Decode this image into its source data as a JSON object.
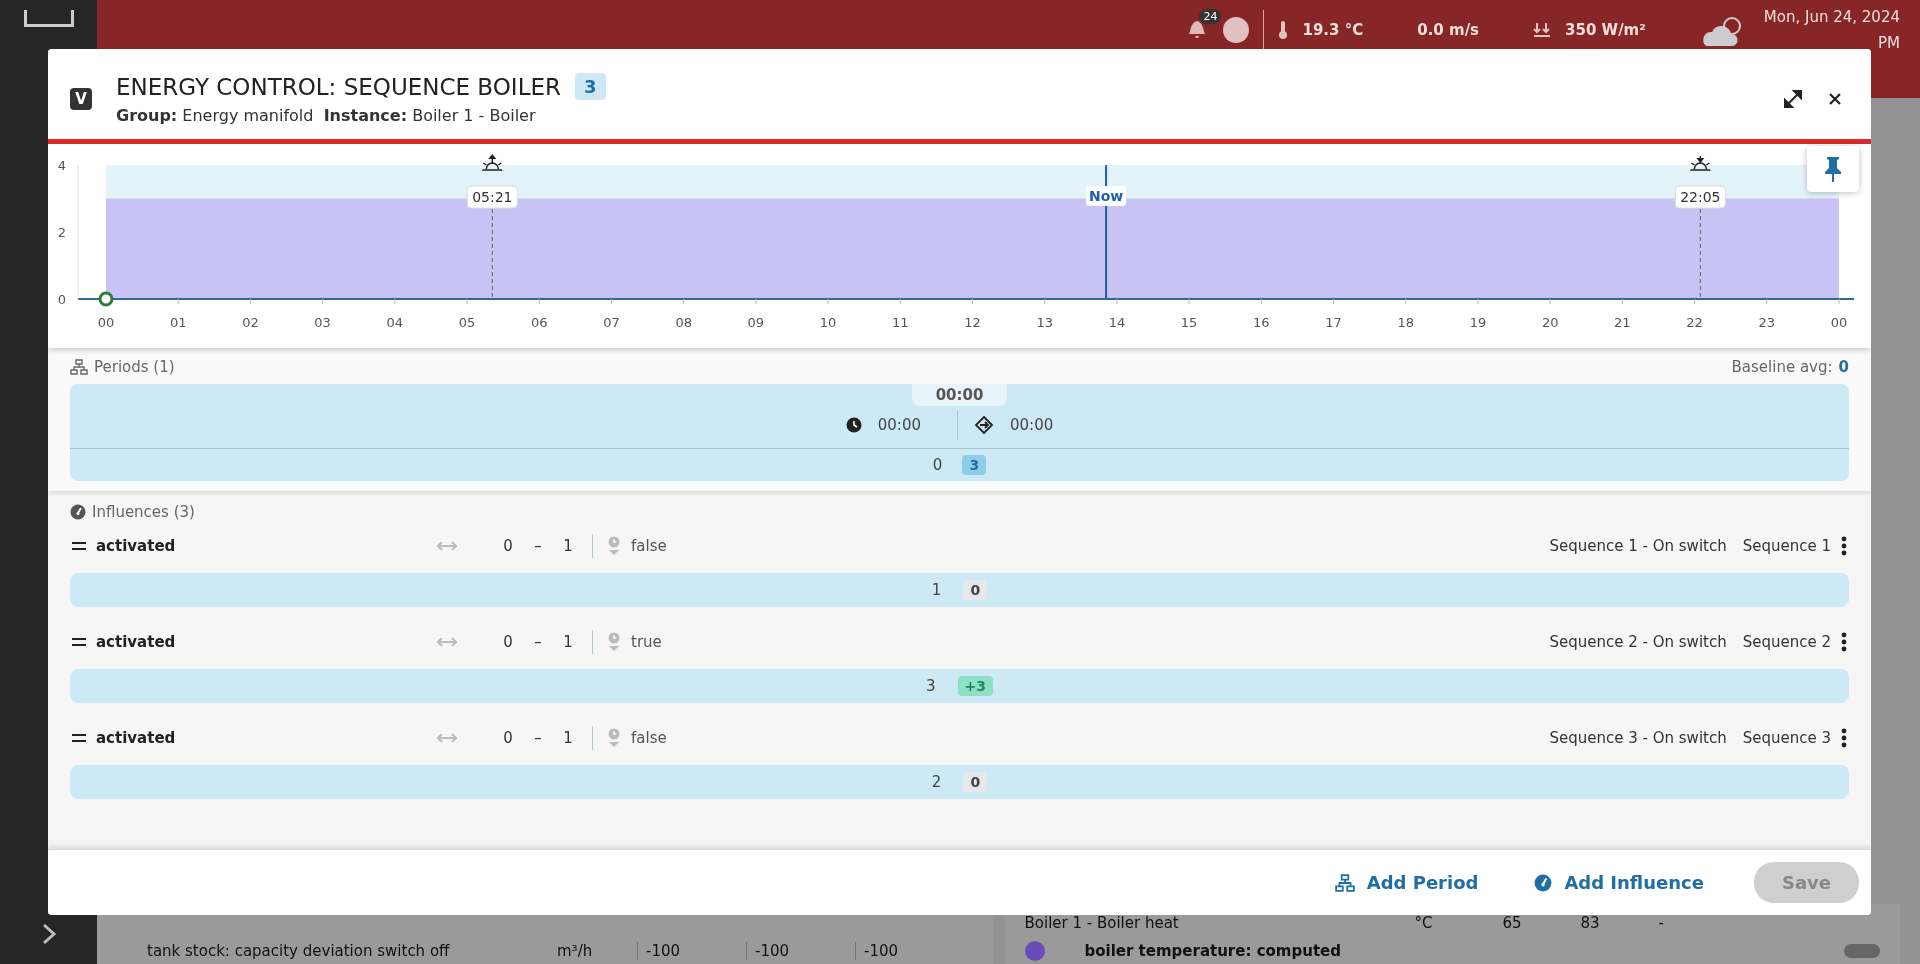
{
  "top_bar": {
    "notifications": "24",
    "temperature": "19.3 °C",
    "wind": "0.0 m/s",
    "radiation": "350 W/m²",
    "date": "Mon, Jun 24, 2024",
    "time": "PM"
  },
  "background_rows": {
    "left": [
      {
        "label": "tank stock: capacity deviation switch off",
        "unit": "m³/h",
        "values": [
          "-100",
          "-100",
          "-100"
        ]
      }
    ],
    "right": [
      {
        "label": "Boiler 1 - Boiler heat",
        "unit": "°C",
        "values": [
          "65",
          "83",
          "-"
        ]
      }
    ],
    "right_item": {
      "label": "boiler temperature: computed",
      "color": "#6a4cb8",
      "on": false
    }
  },
  "dialog": {
    "badge_letter": "V",
    "title": "ENERGY CONTROL: SEQUENCE BOILER",
    "count": "3",
    "subtitle": "**Group:** Energy manifold  **Instance:** Boiler 1 - Boiler",
    "chart_data": {
      "type": "area",
      "xlim": [
        0,
        24
      ],
      "ylim": [
        0,
        4
      ],
      "yticks": [
        0,
        2,
        4
      ],
      "xticks": [
        {
          "value": 0,
          "label": "00"
        },
        {
          "value": 1,
          "label": "01"
        },
        {
          "value": 2,
          "label": "02"
        },
        {
          "value": 3,
          "label": "03"
        },
        {
          "value": 4,
          "label": "04"
        },
        {
          "value": 5,
          "label": "05"
        },
        {
          "value": 6,
          "label": "06"
        },
        {
          "value": 7,
          "label": "07"
        },
        {
          "value": 8,
          "label": "08"
        },
        {
          "value": 9,
          "label": "09"
        },
        {
          "value": 10,
          "label": "10"
        },
        {
          "value": 11,
          "label": "11"
        },
        {
          "value": 12,
          "label": "12"
        },
        {
          "value": 13,
          "label": "13"
        },
        {
          "value": 14,
          "label": "14"
        },
        {
          "value": 15,
          "label": "15"
        },
        {
          "value": 16,
          "label": "16"
        },
        {
          "value": 17,
          "label": "17"
        },
        {
          "value": 18,
          "label": "18"
        },
        {
          "value": 19,
          "label": "19"
        },
        {
          "value": 20,
          "label": "20"
        },
        {
          "value": 21,
          "label": "21"
        },
        {
          "value": 22,
          "label": "22"
        },
        {
          "value": 23,
          "label": "23"
        },
        {
          "value": 24,
          "label": "00"
        }
      ],
      "x": [
        0,
        24
      ],
      "series": [
        {
          "color": "#c9c2f4",
          "values": [
            3,
            3
          ]
        }
      ],
      "ref_lines": [
        {
          "axis": "x",
          "value": 5.35,
          "label": "05:21"
        },
        {
          "axis": "x",
          "value": 13.85,
          "label": "Now",
          "color": "#1e5fa8"
        },
        {
          "axis": "x",
          "value": 22.08,
          "label": "22:05"
        }
      ]
    },
    "chart_markers": [
      {
        "kind": "sunrise"
      },
      {
        "kind": "now"
      },
      {
        "kind": "sunset"
      }
    ],
    "periods": {
      "label": "Periods (1)",
      "baseline_label": "Baseline avg:",
      "baseline_value": "0",
      "items": [
        {
          "tab": "00:00",
          "start": "00:00",
          "duration": "00:00",
          "amount": "0",
          "delta": "3"
        }
      ]
    },
    "influences": {
      "label": "Influences (3)",
      "items": [
        {
          "name": "activated",
          "from": "0",
          "dash": "–",
          "to": "1",
          "value": "false",
          "source": "Sequence 1 - On switch",
          "target": "Sequence 1",
          "amount": "1",
          "delta": "0",
          "kind": "neutral"
        },
        {
          "name": "activated",
          "from": "0",
          "dash": "–",
          "to": "1",
          "value": "true",
          "source": "Sequence 2 - On switch",
          "target": "Sequence 2",
          "amount": "3",
          "delta": "+3",
          "kind": "positive"
        },
        {
          "name": "activated",
          "from": "0",
          "dash": "–",
          "to": "1",
          "value": "false",
          "source": "Sequence 3 - On switch",
          "target": "Sequence 3",
          "amount": "2",
          "delta": "0",
          "kind": "neutral"
        }
      ]
    },
    "footer": {
      "add_period": "Add Period",
      "add_influence": "Add Influence",
      "save": "Save",
      "save_disabled": true
    }
  }
}
